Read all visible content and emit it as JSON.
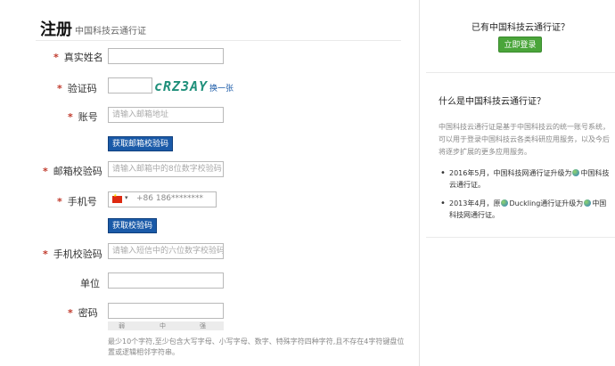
{
  "header": {
    "title": "注册",
    "subtitle": "中国科技云通行证"
  },
  "form": {
    "name_label": "真实姓名",
    "captcha_label": "验证码",
    "captcha_text": "cRZ3AY",
    "captcha_refresh": "换一张",
    "account_label": "账号",
    "account_placeholder": "请输入邮箱地址",
    "email_code_button": "获取邮箱校验码",
    "email_code_label": "邮箱校验码",
    "email_code_placeholder": "请输入邮箱中的8位数字校验码",
    "phone_label": "手机号",
    "phone_value": "+86 186********",
    "sms_code_button": "获取校验码",
    "sms_code_label": "手机校验码",
    "sms_code_placeholder": "请输入短信中的六位数字校验码",
    "unit_label": "单位",
    "password_label": "密码",
    "strength": [
      "弱",
      "中",
      "强"
    ],
    "password_hint": "最少10个字符,至少包含大写字母、小写字母、数字、特殊字符四种字符,且不存在4字符键盘位置或逻辑相邻字符串。"
  },
  "sidebar": {
    "question": "已有中国科技云通行证？",
    "login_button": "立即登录",
    "what_title": "什么是中国科技云通行证？",
    "description": "中国科技云通行证是基于中国科技云的统一账号系统，可以用于登录中国科技云各类科研应用服务，以及今后将逐步扩展的更多应用服务。",
    "news": [
      {
        "year": "2016年5月",
        "text": "，中国科技网通行证升级为",
        "product": "中国科技云通行证。"
      },
      {
        "year": "2013年4月",
        "text": "，原",
        "product": "Duckling通行证升级为",
        "tail": "中国科技网通行证。"
      }
    ]
  }
}
